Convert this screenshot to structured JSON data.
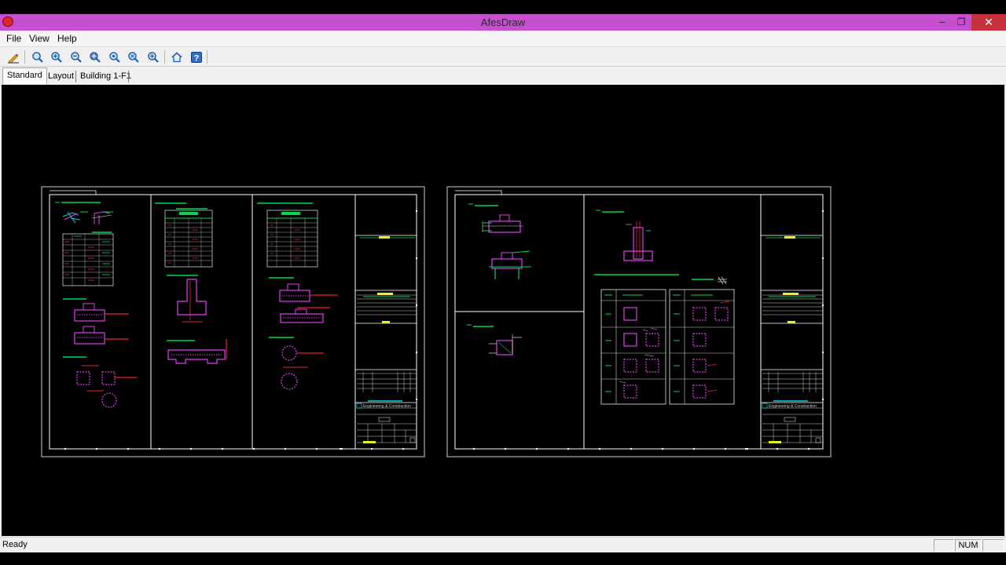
{
  "window": {
    "title": "AfesDraw",
    "minimize_label": "–",
    "restore_label": "❐",
    "close_label": "✕"
  },
  "menu": {
    "items": [
      {
        "label": "File"
      },
      {
        "label": "View"
      },
      {
        "label": "Help"
      }
    ]
  },
  "toolbar": {
    "tools": [
      "pencil-icon",
      "zoom-icon",
      "zoom-in-icon",
      "zoom-out-icon",
      "zoom-window-icon",
      "zoom-all-icon",
      "zoom-extents-icon",
      "zoom-previous-icon",
      "home-icon",
      "help-icon"
    ]
  },
  "tabs": [
    {
      "label": "Standard",
      "active": true
    },
    {
      "label": "Layout",
      "active": false
    },
    {
      "label": "Building 1-F1",
      "active": false
    }
  ],
  "status": {
    "text": "Ready",
    "num_label": "NUM"
  },
  "title_block": {
    "company": "Engineering & Construction"
  },
  "colors": {
    "title_bar": "#c64fd0",
    "drawing_green": "#00d84a",
    "drawing_magenta": "#e040f0",
    "drawing_red": "#e8222a",
    "drawing_yellow": "#f0f020",
    "drawing_cyan": "#10d0e0",
    "canvas": "#000000"
  }
}
